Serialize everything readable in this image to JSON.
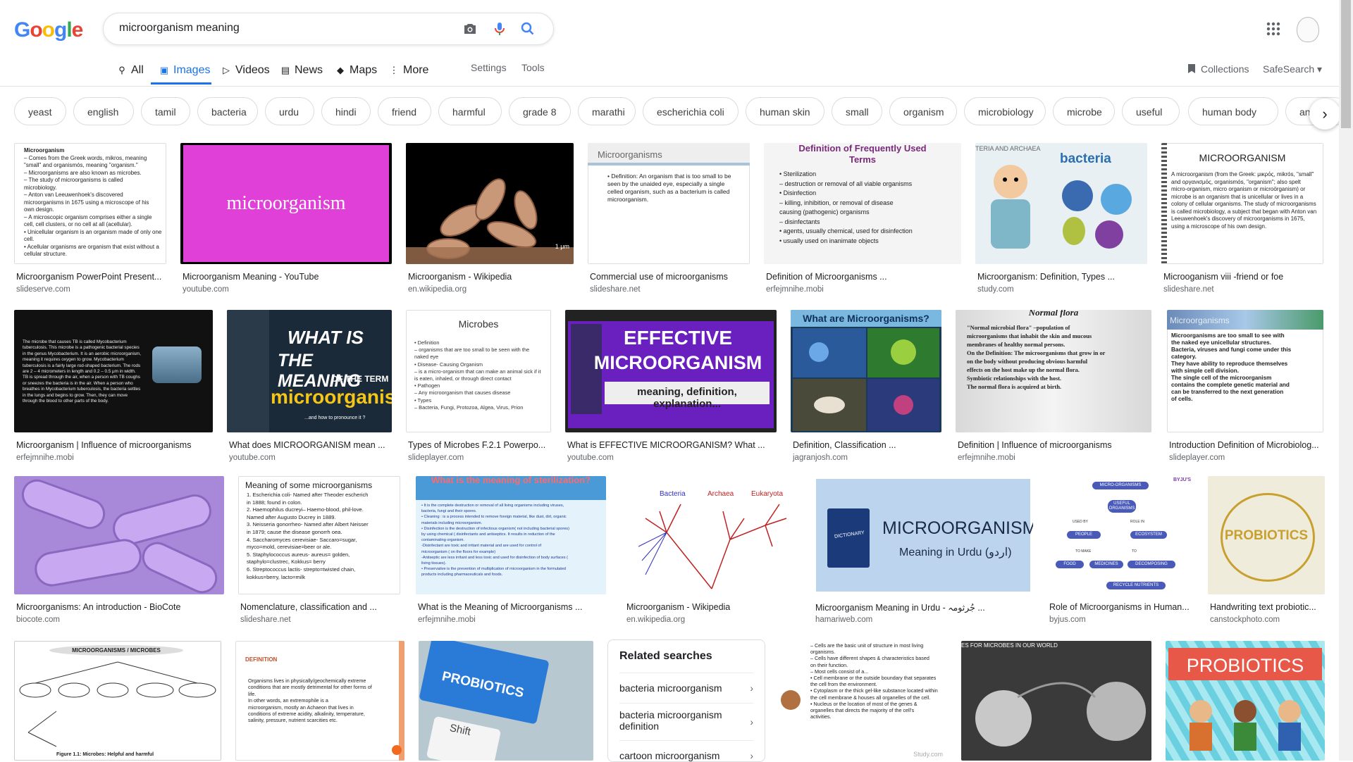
{
  "logo": {
    "letters": [
      "G",
      "o",
      "o",
      "g",
      "l",
      "e"
    ],
    "colors": [
      "#4285f4",
      "#ea4335",
      "#fbbc05",
      "#4285f4",
      "#34a853",
      "#ea4335"
    ]
  },
  "search": {
    "value": "microorganism meaning"
  },
  "tabs": [
    {
      "label": "All",
      "icon": "search-icon"
    },
    {
      "label": "Images",
      "icon": "image-icon"
    },
    {
      "label": "Videos",
      "icon": "play-icon"
    },
    {
      "label": "News",
      "icon": "news-icon"
    },
    {
      "label": "Maps",
      "icon": "map-icon"
    },
    {
      "label": "More",
      "icon": "dots-vertical-icon"
    }
  ],
  "tools": {
    "settings": "Settings",
    "tools": "Tools",
    "collections": "Collections",
    "safesearch": "SafeSearch"
  },
  "chips": [
    "yeast",
    "english",
    "tamil",
    "bacteria",
    "urdu",
    "hindi",
    "friend",
    "harmful",
    "grade 8",
    "marathi",
    "escherichia coli",
    "human skin",
    "small",
    "organism",
    "microbiology",
    "microbe",
    "useful",
    "human body",
    "anim"
  ],
  "results": [
    {
      "title": "Microorganism PowerPoint Present...",
      "source": "slideserve.com"
    },
    {
      "title": "Microorganism Meaning - YouTube",
      "source": "youtube.com"
    },
    {
      "title": "Microorganism - Wikipedia",
      "source": "en.wikipedia.org"
    },
    {
      "title": "Commercial use of microorganisms",
      "source": "slideshare.net"
    },
    {
      "title": "Definition of Microorganisms ...",
      "source": "erfejmnihe.mobi"
    },
    {
      "title": "Microorganism: Definition, Types ...",
      "source": "study.com"
    },
    {
      "title": "Microoganism viii -friend or foe",
      "source": "slideshare.net"
    },
    {
      "title": "Microorganism | Influence of microorganisms",
      "source": "erfejmnihe.mobi"
    },
    {
      "title": "What does MICROORGANISM mean ...",
      "source": "youtube.com"
    },
    {
      "title": "Types of Microbes F.2.1 Powerpo...",
      "source": "slideplayer.com"
    },
    {
      "title": "What is EFFECTIVE MICROORGANISM? What ...",
      "source": "youtube.com"
    },
    {
      "title": "Definition, Classification ...",
      "source": "jagranjosh.com"
    },
    {
      "title": "Definition | Influence of microorganisms",
      "source": "erfejmnihe.mobi"
    },
    {
      "title": "Introduction Definition of Microbiolog...",
      "source": "slideplayer.com"
    },
    {
      "title": "Microorganisms: An introduction - BioCote",
      "source": "biocote.com"
    },
    {
      "title": "Nomenclature, classification and ...",
      "source": "slideshare.net"
    },
    {
      "title": "What is the Meaning of Microorganisms ...",
      "source": "erfejmnihe.mobi"
    },
    {
      "title": "Microorganism - Wikipedia",
      "source": "en.wikipedia.org"
    },
    {
      "title": "Microorganism Meaning in Urdu - جُرثومہ ...",
      "source": "hamariweb.com"
    },
    {
      "title": "Role of Microorganisms in Human...",
      "source": "byjus.com"
    },
    {
      "title": "Handwriting text probiotic...",
      "source": "canstockphoto.com"
    }
  ],
  "thumb_text": {
    "t1": {
      "heading": "Microorganism",
      "lines": [
        "– Comes from the Greek words, mikros, meaning",
        "\"small\" and organismós, meaning \"organism.\"",
        "– Microorganisms are also known as microbes.",
        "– The study of microorganisms is called",
        "microbiology.",
        "– Anton van Leeuwenhoek's discovered",
        "microorganisms in 1675 using a microscope of his",
        "own design.",
        "– A microscopic organism comprises either a single",
        "cell, cell clusters, or no cell at all (acellular).",
        "• Unicellular organism is an organism made of only one",
        "cell.",
        "• Acellular organisms are organism that exist without a",
        "cellular structure."
      ]
    },
    "t2": "microorganism",
    "t3": "1 μm",
    "t4": {
      "heading": "Microorganisms",
      "body": "• Definition: An organism that is too small to be seen by the unaided eye, especially a single celled organism, such as a bacterium is called microorganism."
    },
    "t5": {
      "heading": "Definition of Frequently Used Terms",
      "lines": [
        "• Sterilization",
        "– destruction or removal of all viable organisms",
        "• Disinfection",
        "– killing, inhibition, or removal of disease",
        "causing (pathogenic) organisms",
        "– disinfectants",
        "• agents, usually chemical, used for disinfection",
        "• usually used on inanimate objects"
      ]
    },
    "t6": {
      "corner": "TERIA AND ARCHAEA",
      "heading": "bacteria"
    },
    "t7": {
      "heading": "MICROORGANISM",
      "body": "A microorganism (from the Greek: μικρός, mikrós, \"small\" and οργανισμός, organismós, \"organism\"; also spelt micro-organism, micro organism or microörganism) or microbe is an organism that is unicellular or lives in a colony of cellular organisms. The study of microorganisms is called microbiology, a subject that began with Anton van Leeuwenhoek's discovery of microorganisms in 1675, using a microscope of his own design."
    },
    "t8": "The microbe that causes TB is called Mycobacterium tuberculosis. This microbe is a pathogenic bacterial species in the genus Mycobacterium. It is an aerobic microorganism, meaning it requires oxygen to grow. Mycobacterium tuberculosis is a fairly large rod-shaped bacterium. The rods are 2 – 4 micrometers in length and 0.2 – 0.5 μm in width. TB is spread through the air, when a person with TB coughs or sneezes the bacteria is in the air. When a person who breathes in Mycobacterium tuberculosis, the bacteria settles in the lungs and begins to grow. Then, they can move through the blood to other parts of the body.",
    "t9": {
      "line1": "WHAT IS",
      "line2": "THE MEANING",
      "line3": "OF THE TERM",
      "line4": "microorganism",
      "line5": "...and how to pronounce it ?"
    },
    "t10": {
      "heading": "Microbes",
      "lines": [
        "• Definition",
        "– organisms that are too small to be seen with the",
        "naked eye",
        "• Disease- Causing Organism",
        "– is a micro-organism that can make an animal sick if it",
        "is eaten, inhaled, or through direct contact",
        "• Pathogen",
        "– Any microorganism that causes disease",
        "• Types",
        "– Bacteria, Fungi, Protozoa, Algea, Virus, Prion"
      ]
    },
    "t11": {
      "line1": "EFFECTIVE",
      "line2": "MICROORGANISM",
      "line3": "meaning, definition, explanation..."
    },
    "t12": "What are Microorganisms?",
    "t13": {
      "top": "Normal flora",
      "lines": [
        "\"Normal microbial flora\" –population of",
        "microorganisms that inhabit the skin and mucous",
        "membranes of healthy normal persons.",
        "On the Definition: The microorganisms that grow in or",
        "on the body without producing obvious harmful",
        "effects on the host make up the normal flora.",
        "Symbiotic relationships with the host.",
        "The normal flora is acquired at birth."
      ]
    },
    "t14": {
      "heading": "Microorganisms",
      "lines": [
        "Microorganisms are too small to see with",
        "the naked eye unicellular structures.",
        "Bacteria, viruses and fungi come under this",
        "category.",
        "They have ability to reproduce themselves",
        "with simple cell division.",
        "The single cell of the microorganism",
        "contains the complete genetic material and",
        "can be transferred to the next generation",
        "of cells."
      ]
    },
    "t16": {
      "heading": "Meaning of some microorganisms",
      "lines": [
        "1. Escherichia coli- Named after Theoder escherich",
        "in 1888; found in colon.",
        "2. Haemophilus ducreyi– Haemo-blood, phil-love.",
        "Named after Augusto Ducrey in 1889.",
        "3. Neisseria gonorrheo- Named after Albert Neisser",
        "in 1879; cause the disease gonorrh oea.",
        "4. Saccharomyces cerevisiae- Saccaro=sugar,",
        "myco=mold, cerevisiae=beer or ale.",
        "5. Staphylococcus aureus- aureus= golden,",
        "staphylo=clustrec, Kokkus= berry",
        "6. Streptococcus lactis- strepto=twisted chain,",
        "kokkus=berry, lacto=milk"
      ]
    },
    "t17": {
      "heading": "What is the meaning of sterilization?",
      "lines": [
        "• It is the complete destruction or removal of all living organisms including viruses,",
        "bacteria, fungi and their spores.",
        "• Cleaning : is a process intended to remove foreign material, like dust, dirt, organic",
        "materials including microorganism.",
        "• Disinfection is the destruction of infectious organism( not including bacterial spores)",
        "by using chemical ( disinfectants and antiseptics. It results in reduction of the",
        "contaminating organism.",
        "-Disinfectant are toxic and irritant material and are used for control of",
        "microorganism ( on the floors for example)",
        "-Antiseptic are less irritant and less toxic and used for disinfection of body surfaces (",
        "living tissues).",
        "• Preservative is the prevention of multiplication of microorganism in the formulated",
        "products including pharmaceuticals and foods."
      ]
    },
    "t18": {
      "labels": [
        "Bacteria",
        "Archaea",
        "Eukaryota"
      ]
    },
    "t19": {
      "line1": "MICROORGANISM",
      "line2": "Meaning in Urdu (اردو)",
      "book": "DICTIONARY"
    },
    "t20": {
      "nodes": [
        "MICRO-ORGANISMS",
        "USEFUL ORGANISMS",
        "PEOPLE",
        "ECOSYSTEM",
        "FOOD",
        "MEDICINES",
        "DECOMPOSING",
        "RECYCLE NUTRIENTS"
      ],
      "small": [
        "USED BY",
        "ROLE IN",
        "TO MAKE",
        "TO"
      ],
      "brand": "BYJU'S"
    },
    "t21": "PROBIOTICS",
    "t22": {
      "heading": "MICROORGANISMS / MICROBES",
      "caption": "Figure 1.1: Microbes: Helpful and harmful"
    },
    "t23": {
      "heading": "DEFINITION",
      "lines": [
        "Organisms lives in physically/geochemically extreme",
        "conditions that are mostly detrimental for other forms of",
        "life.",
        "In other words, an extremophile is a",
        "microorganism, mostly an Achaeon that lives in",
        "conditions of extreme acidity, alkalinity, temperature,",
        "salinity, pressure, nutrient scarcities etc."
      ]
    },
    "t24": {
      "key": "PROBIOTICS",
      "shift": "Shift"
    },
    "t26": {
      "lines": [
        "– Cells are the basic unit of structure in most living",
        "organisms.",
        "– Cells have different shapes & characteristics based",
        "on their function.",
        "– Most cells consist of a...",
        "• Cell membrane or the outside boundary that separates",
        "the cell from the environment.",
        "• Cytoplasm or the thick gel-like substance located within",
        "the cell membrane & houses all organelles of the cell.",
        "• Nucleus or the location of most of the genes &",
        "organelles that directs the majority of the cell's",
        "activities."
      ],
      "brand": "Study.com"
    },
    "t27": "ES FOR MICROBES IN OUR WORLD",
    "t28": "PROBIOTICS"
  },
  "related": {
    "heading": "Related searches",
    "items": [
      "bacteria microorganism",
      "bacteria microorganism definition",
      "cartoon microorganism"
    ]
  }
}
